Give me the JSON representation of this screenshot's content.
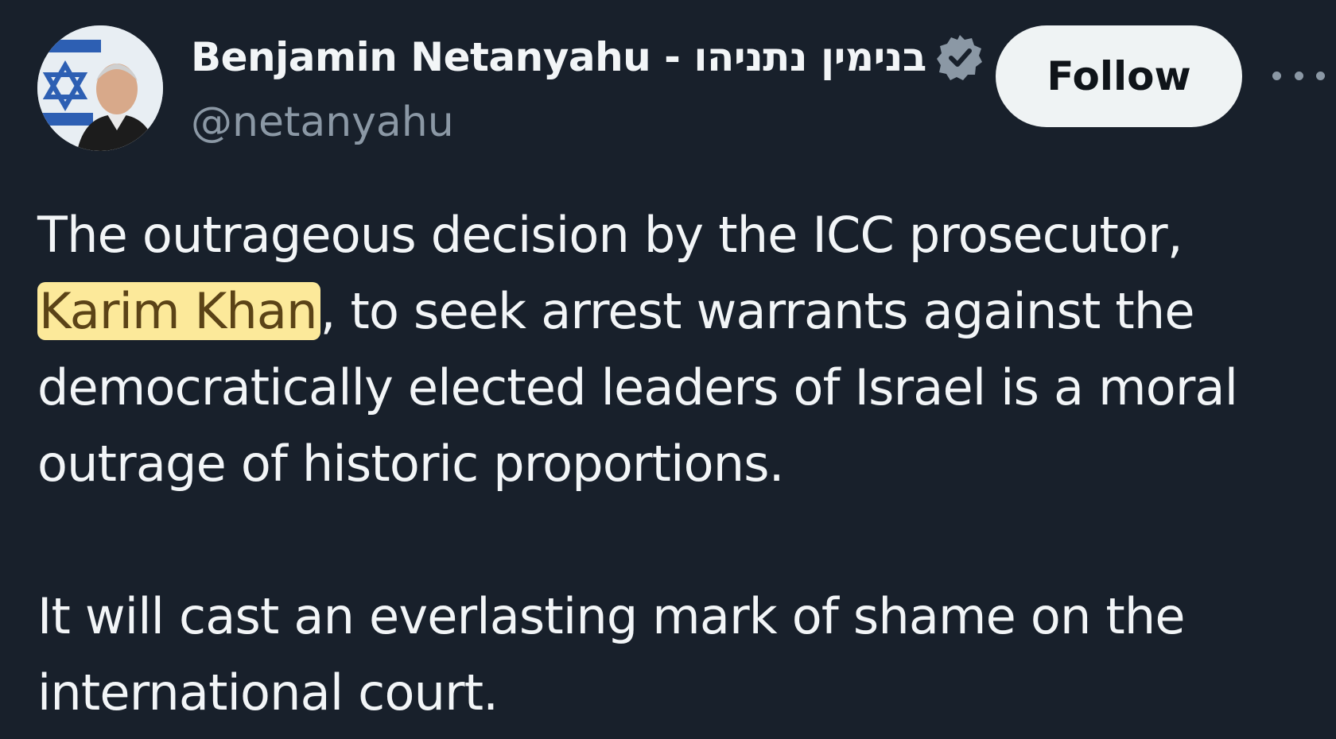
{
  "author": {
    "display_name": "Benjamin Netanyahu - בנימין נתניהו",
    "handle": "@netanyahu",
    "avatar_icon": "profile-photo",
    "verified_icon": "verified-badge-icon",
    "verified_color": "#8b98a5"
  },
  "actions": {
    "follow_label": "Follow",
    "more_icon": "more-options-icon"
  },
  "tweet": {
    "p1_before": "The outrageous decision by the ICC prosecutor, ",
    "p1_highlight": "Karim Khan",
    "p1_after": ", to seek arrest warrants against the democratically elected leaders of Israel is a moral outrage of historic proportions.",
    "p2": "It will cast an everlasting mark of shame on the international court."
  },
  "colors": {
    "background": "#18202b",
    "text": "#f2f5f7",
    "muted": "#8b98a5",
    "highlight_bg": "#fce99a",
    "highlight_text": "#5b4317"
  }
}
